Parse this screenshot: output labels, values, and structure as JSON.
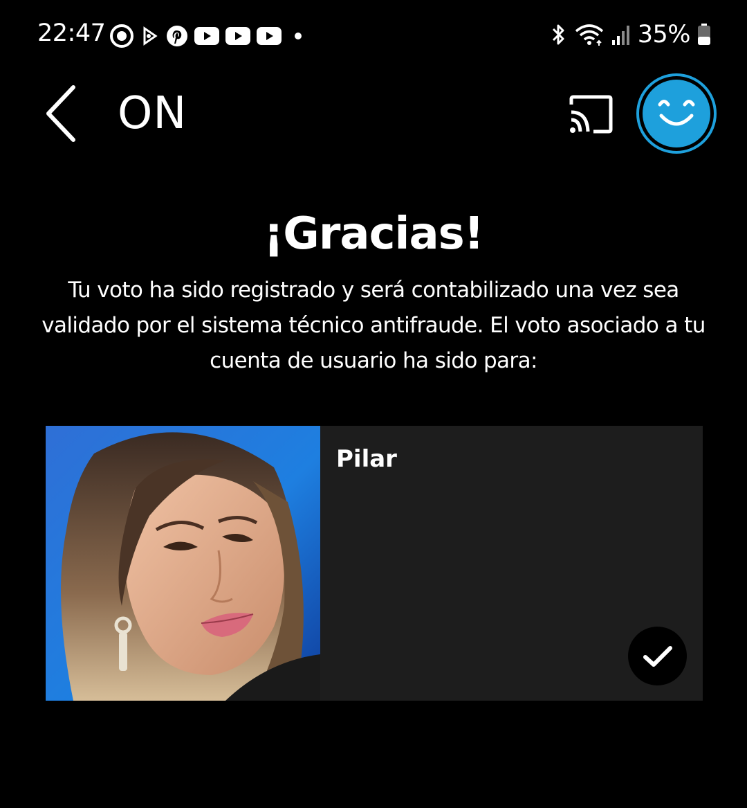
{
  "status_bar": {
    "time": "22:47",
    "battery_percent": "35%",
    "notification_icons": [
      "circle-app-icon",
      "play-store-icon",
      "pinterest-icon",
      "youtube-icon",
      "youtube-icon",
      "youtube-icon",
      "more-dot-icon"
    ],
    "system_icons": [
      "bluetooth-icon",
      "wifi-icon",
      "signal-icon",
      "battery-icon"
    ]
  },
  "header": {
    "title": "ON",
    "back_icon": "chevron-left-icon",
    "cast_icon": "cast-icon",
    "avatar_icon": "smiley-icon",
    "accent_color": "#1ea0dc"
  },
  "confirmation": {
    "title": "¡Gracias!",
    "message": "Tu voto ha sido registrado y será contabilizado una vez sea validado por el sistema técnico antifraude. El voto asociado a tu cuenta de usuario ha sido para:"
  },
  "vote": {
    "contestant_name": "Pilar",
    "selected": true,
    "check_icon": "check-icon",
    "card_color": "#1d1d1d"
  }
}
